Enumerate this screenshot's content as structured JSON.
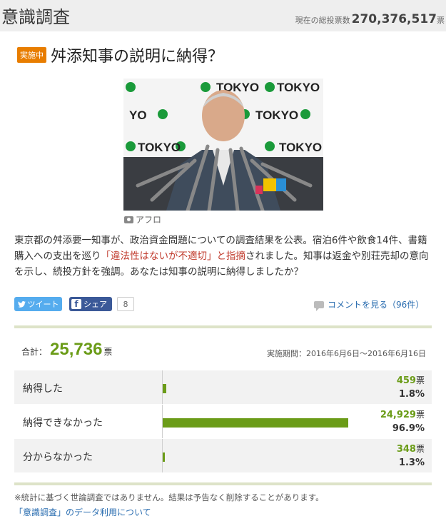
{
  "header": {
    "title": "意識調査",
    "total_label": "現在の総投票数",
    "total_value": "270,376,517",
    "total_unit": "票"
  },
  "question": {
    "badge": "実施中",
    "title": "舛添知事の説明に納得？",
    "photo_credit": "アフロ",
    "description_1": "東京都の舛添要一知事が、政治資金問題についての調査結果を公表。宿泊6件や飲食14件、書籍購入への支出を巡り",
    "description_highlight": "「違法性はないが不適切」と指摘",
    "description_2": "されました。知事は返金や別荘売却の意向を示し、続投方針を強調。あなたは知事の説明に納得しましたか？"
  },
  "social": {
    "tweet_label": "ツイート",
    "share_label": "シェア",
    "share_count": "8",
    "comment_link": "コメントを見る（96件）"
  },
  "summary": {
    "total_label": "合計：",
    "total_votes": "25,736",
    "total_unit": "票",
    "period": "実施期間：2016年6月6日〜2016年6月16日"
  },
  "results": [
    {
      "label": "納得した",
      "votes": "459",
      "unit": "票",
      "percent": "1.8%",
      "share": 0.018
    },
    {
      "label": "納得できなかった",
      "votes": "24,929",
      "unit": "票",
      "percent": "96.9%",
      "share": 0.969
    },
    {
      "label": "分からなかった",
      "votes": "348",
      "unit": "票",
      "percent": "1.3%",
      "share": 0.013
    }
  ],
  "footer": {
    "note": "※統計に基づく世論調査ではありません。結果は予告なく削除することがあります。",
    "data_link": "「意識調査」のデータ利用について"
  },
  "colors": {
    "accent_green": "#6b9c18",
    "badge_orange": "#e87d00",
    "link_blue": "#2a6db0"
  }
}
